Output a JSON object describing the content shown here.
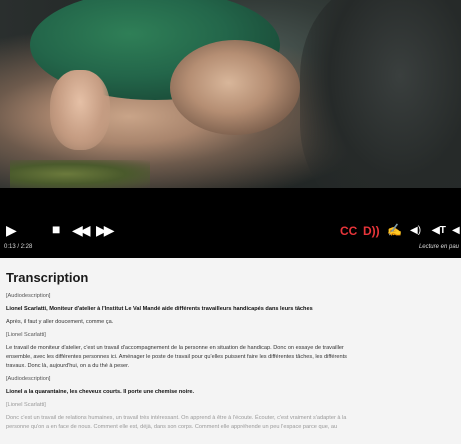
{
  "player": {
    "time": "0:13 / 2:28",
    "status": "Lecture en pau",
    "controls": {
      "cc": "CC",
      "audiodesc": "D))",
      "sign": "✍",
      "volume": "◀)",
      "text_size": "◀T",
      "more": "◀"
    }
  },
  "transcription": {
    "title": "Transcription",
    "lines": [
      "[Audiodescription]",
      "Lionel Scarlatti, Moniteur d'atelier à l'Institut Le Val Mandé aide différents travailleurs handicapés dans leurs tâches",
      "Après, il faut y aller doucement, comme ça.",
      "[Lionel Scarlatti]",
      "Le travail de moniteur d'atelier, c'est un travail d'accompagnement de la personne en situation de handicap. Donc on essaye de travailler",
      "ensemble, avec les différentes personnes ici. Aménager le poste de travail pour qu'elles puissent faire les différentes tâches, les différents",
      "travaux. Donc là, aujourd'hui, on a du thé à peser.",
      "[Audiodescription]",
      "Lionel a la quarantaine, les cheveux courts. Il porte une chemise noire.",
      "[Lionel Scarlatti]",
      "Donc c'est un travail de relations humaines, un travail très intéressant. On apprend à être à l'écoute. Écouter, c'est vraiment s'adapter à la",
      "personne qu'on a en face de nous. Comment elle est, déjà, dans son corps. Comment elle appréhende un peu l'espace parce que, au"
    ]
  }
}
